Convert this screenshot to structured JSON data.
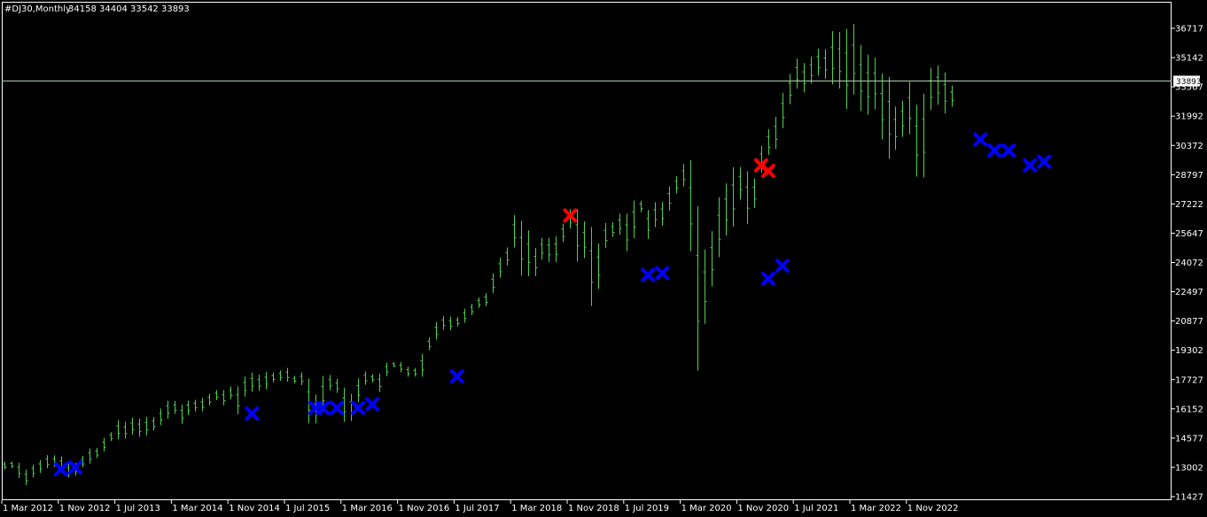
{
  "header": {
    "symbol_timeframe": "#DJ30,Monthly",
    "ohlc": "34158 34404 33542 33893"
  },
  "colors": {
    "background": "#000000",
    "frame": "#ffffff",
    "bars": "#4fd04f",
    "price_line": "#b0d0b0",
    "marker_buy": "#0000ff",
    "marker_sell": "#ff0000",
    "price_tag_bg": "#ffffff",
    "price_tag_text": "#000000"
  },
  "chart_data": {
    "type": "ohlc",
    "grid": false,
    "x_tick_labels": [
      "1 Mar 2012",
      "1 Nov 2012",
      "1 Jul 2013",
      "1 Mar 2014",
      "1 Nov 2014",
      "1 Jul 2015",
      "1 Mar 2016",
      "1 Nov 2016",
      "1 Jul 2017",
      "1 Mar 2018",
      "1 Nov 2018",
      "1 Jul 2019",
      "1 Mar 2020",
      "1 Nov 2020",
      "1 Jul 2021",
      "1 Mar 2022",
      "1 Nov 2022"
    ],
    "y_tick_labels": [
      "36717",
      "35142",
      "33567",
      "31992",
      "30372",
      "28797",
      "27222",
      "25647",
      "24072",
      "22497",
      "20877",
      "19302",
      "17727",
      "16152",
      "14577",
      "13002",
      "11427"
    ],
    "ylim": [
      11427,
      37492
    ],
    "current_price": 33893,
    "current_price_label": "33893",
    "x_start": "Feb 2012",
    "bars_hl": [
      [
        13310,
        12890
      ],
      [
        13320,
        12960
      ],
      [
        13250,
        12430
      ],
      [
        12880,
        12040
      ],
      [
        13150,
        12470
      ],
      [
        13400,
        12700
      ],
      [
        13660,
        12950
      ],
      [
        13650,
        13020
      ],
      [
        13580,
        12820
      ],
      [
        13210,
        12470
      ],
      [
        13230,
        12570
      ],
      [
        13620,
        13000
      ],
      [
        14020,
        13200
      ],
      [
        14050,
        13500
      ],
      [
        14580,
        13860
      ],
      [
        14890,
        14420
      ],
      [
        15540,
        14520
      ],
      [
        15450,
        14550
      ],
      [
        15660,
        14760
      ],
      [
        15620,
        14650
      ],
      [
        15710,
        14720
      ],
      [
        15710,
        14980
      ],
      [
        16170,
        15280
      ],
      [
        16590,
        15620
      ],
      [
        16580,
        15880
      ],
      [
        16380,
        15340
      ],
      [
        16590,
        15820
      ],
      [
        16640,
        16020
      ],
      [
        16740,
        16020
      ],
      [
        16950,
        16330
      ],
      [
        17160,
        16620
      ],
      [
        17160,
        16340
      ],
      [
        17350,
        16670
      ],
      [
        17360,
        15860
      ],
      [
        17890,
        16810
      ],
      [
        18100,
        17070
      ],
      [
        17990,
        17120
      ],
      [
        18130,
        17210
      ],
      [
        18100,
        17580
      ],
      [
        18220,
        17660
      ],
      [
        18350,
        17620
      ],
      [
        17920,
        17530
      ],
      [
        18110,
        17430
      ],
      [
        17780,
        15370
      ],
      [
        16930,
        15370
      ],
      [
        17920,
        16010
      ],
      [
        17980,
        17140
      ],
      [
        17760,
        17020
      ],
      [
        17280,
        15450
      ],
      [
        16960,
        15500
      ],
      [
        17790,
        16500
      ],
      [
        18170,
        17450
      ],
      [
        18010,
        17580
      ],
      [
        18040,
        17060
      ],
      [
        18640,
        17920
      ],
      [
        18670,
        18380
      ],
      [
        18670,
        18120
      ],
      [
        18420,
        17880
      ],
      [
        18350,
        17890
      ],
      [
        19100,
        17880
      ],
      [
        19990,
        19310
      ],
      [
        20820,
        19880
      ],
      [
        21160,
        20410
      ],
      [
        21120,
        20380
      ],
      [
        21100,
        20580
      ],
      [
        21560,
        20790
      ],
      [
        21830,
        21200
      ],
      [
        22180,
        21600
      ],
      [
        22420,
        21700
      ],
      [
        23480,
        22420
      ],
      [
        24330,
        23250
      ],
      [
        24880,
        23920
      ],
      [
        26620,
        24880
      ],
      [
        26310,
        23360
      ],
      [
        25800,
        23340
      ],
      [
        24860,
        23340
      ],
      [
        25400,
        24220
      ],
      [
        25400,
        24090
      ],
      [
        25490,
        24090
      ],
      [
        26170,
        25170
      ],
      [
        26950,
        25900
      ],
      [
        26950,
        24120
      ],
      [
        26280,
        24300
      ],
      [
        25980,
        21710
      ],
      [
        25100,
        22640
      ],
      [
        26200,
        24860
      ],
      [
        26240,
        25450
      ],
      [
        26700,
        25560
      ],
      [
        26700,
        24680
      ],
      [
        27400,
        25380
      ],
      [
        27400,
        26780
      ],
      [
        26900,
        25340
      ],
      [
        27310,
        25980
      ],
      [
        27330,
        26050
      ],
      [
        28170,
        26860
      ],
      [
        28710,
        27790
      ],
      [
        29370,
        28170
      ],
      [
        29570,
        24680
      ],
      [
        27100,
        18210
      ],
      [
        24760,
        20730
      ],
      [
        25760,
        22790
      ],
      [
        27580,
        24360
      ],
      [
        28330,
        25520
      ],
      [
        29200,
        25990
      ],
      [
        29210,
        27460
      ],
      [
        28980,
        26140
      ],
      [
        28600,
        27010
      ],
      [
        30350,
        28900
      ],
      [
        31270,
        29860
      ],
      [
        31960,
        30180
      ],
      [
        33250,
        31330
      ],
      [
        34260,
        32630
      ],
      [
        35090,
        33470
      ],
      [
        34850,
        33270
      ],
      [
        35200,
        33740
      ],
      [
        35630,
        34170
      ],
      [
        35600,
        34000
      ],
      [
        36570,
        33700
      ],
      [
        36520,
        33480
      ],
      [
        36680,
        32380
      ],
      [
        36950,
        33150
      ],
      [
        35830,
        32270
      ],
      [
        35300,
        32070
      ],
      [
        35140,
        32360
      ],
      [
        34280,
        30700
      ],
      [
        34100,
        29650
      ],
      [
        32510,
        30140
      ],
      [
        32830,
        30850
      ],
      [
        33830,
        31000
      ],
      [
        32610,
        28690
      ],
      [
        33200,
        28650
      ],
      [
        34590,
        32320
      ],
      [
        34720,
        32600
      ],
      [
        34350,
        32130
      ],
      [
        33630,
        32500
      ]
    ],
    "buy_markers": [
      {
        "bar": 8,
        "price": 12900
      },
      {
        "bar": 10,
        "price": 13000
      },
      {
        "bar": 35,
        "price": 15900
      },
      {
        "bar": 44,
        "price": 16200
      },
      {
        "bar": 45,
        "price": 16200
      },
      {
        "bar": 47,
        "price": 16200
      },
      {
        "bar": 50,
        "price": 16200
      },
      {
        "bar": 52,
        "price": 16400
      },
      {
        "bar": 64,
        "price": 17900
      },
      {
        "bar": 91,
        "price": 23400
      },
      {
        "bar": 93,
        "price": 23500
      },
      {
        "bar": 108,
        "price": 23200
      },
      {
        "bar": 110,
        "price": 23900
      },
      {
        "bar": 138,
        "price": 30700
      },
      {
        "bar": 140,
        "price": 30100
      },
      {
        "bar": 142,
        "price": 30100
      },
      {
        "bar": 145,
        "price": 29300
      },
      {
        "bar": 147,
        "price": 29500
      }
    ],
    "sell_markers": [
      {
        "bar": 80,
        "price": 26600
      },
      {
        "bar": 107,
        "price": 29300
      },
      {
        "bar": 108,
        "price": 29000
      }
    ]
  }
}
